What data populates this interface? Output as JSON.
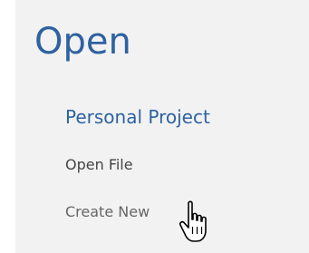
{
  "panel": {
    "title": "Open",
    "items": [
      {
        "label": "Personal Project"
      },
      {
        "label": "Open File"
      },
      {
        "label": "Create New"
      }
    ]
  },
  "cursor": {
    "icon": "hand-pointer-icon"
  }
}
